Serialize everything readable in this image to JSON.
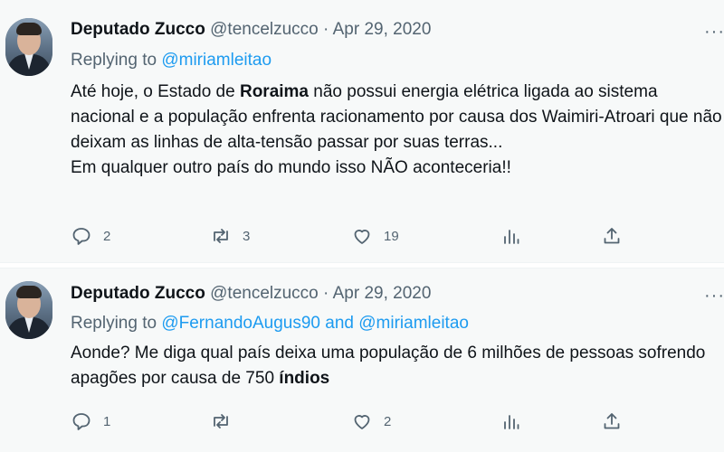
{
  "tweets": [
    {
      "author_name": "Deputado Zucco",
      "handle": "@tencelzucco",
      "separator": "·",
      "date": "Apr 29, 2020",
      "more_label": "···",
      "replying_prefix": "Replying to",
      "replying_to_1": "@miriamleitao",
      "body_part1": "Até hoje, o Estado de ",
      "body_bold": "Roraima",
      "body_part2": " não possui energia elétrica ligada ao sistema nacional e a população enfrenta racionamento por causa dos Waimiri-Atroari que não deixam as linhas de alta-tensão passar por suas terras...\nEm qualquer outro país do mundo isso NÃO aconteceria!!",
      "reply_count": "2",
      "retweet_count": "3",
      "like_count": "19"
    },
    {
      "author_name": "Deputado Zucco",
      "handle": "@tencelzucco",
      "separator": "·",
      "date": "Apr 29, 2020",
      "more_label": "···",
      "replying_prefix": "Replying to",
      "replying_to_1": "@FernandoAugus90",
      "replying_and": "and",
      "replying_to_2": "@miriamleitao",
      "body_part1": "Aonde? Me diga qual país deixa uma população de 6 milhões de pessoas sofrendo apagões por causa de 750 ",
      "body_bold": "índios",
      "reply_count": "1",
      "like_count": "2"
    }
  ],
  "icons": {
    "reply": "reply-icon",
    "retweet": "retweet-icon",
    "like": "heart-icon",
    "views": "analytics-icon",
    "share": "share-icon"
  },
  "colors": {
    "link": "#1d9bf0",
    "secondary_text": "#536471",
    "card_background": "#f7f9f9"
  }
}
